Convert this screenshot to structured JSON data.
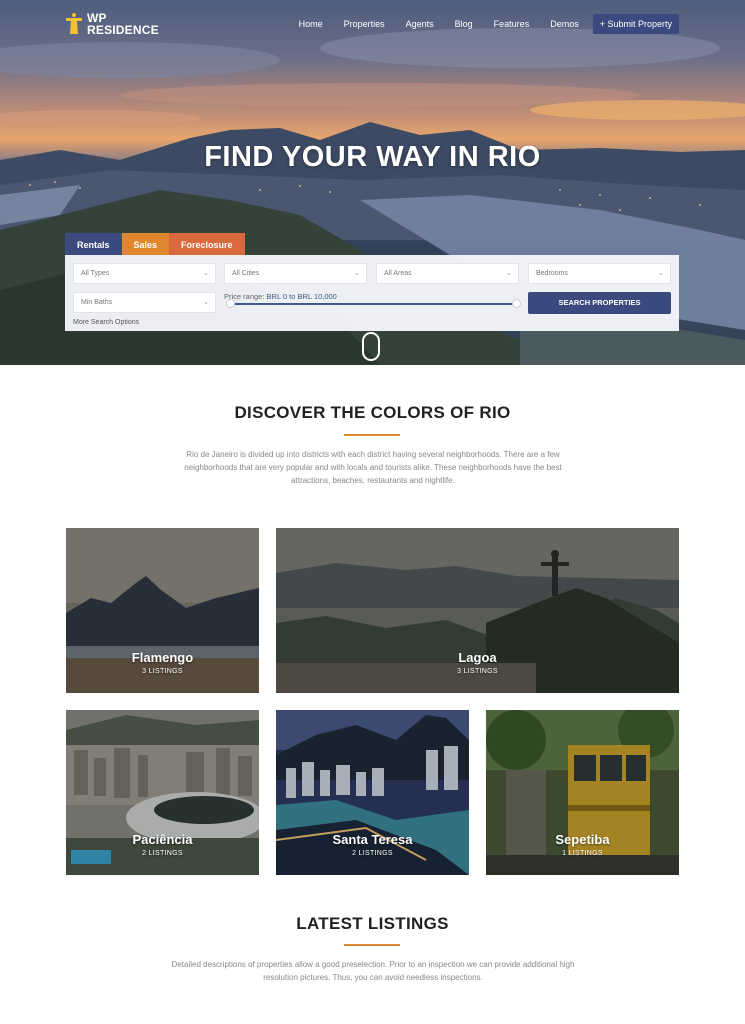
{
  "brand": {
    "line1": "WP",
    "line2": "RESIDENCE"
  },
  "nav": {
    "items": [
      "Home",
      "Properties",
      "Agents",
      "Blog",
      "Features",
      "Demos"
    ],
    "cta": "+ Submit Property"
  },
  "hero": {
    "title": "FIND YOUR WAY IN RIO"
  },
  "search": {
    "tabs": [
      "Rentals",
      "Sales",
      "Foreclosure"
    ],
    "fields": [
      "All Types",
      "All Cities",
      "All Areas",
      "Bedrooms",
      "Min Baths"
    ],
    "price_range_label": "Price range:",
    "price_range_value": "BRL 0 to BRL 10,000",
    "price_range_fraction": [
      0,
      1
    ],
    "button": "SEARCH PROPERTIES",
    "more": "More Search Options"
  },
  "discover": {
    "title": "DISCOVER THE COLORS OF RIO",
    "description": "Rio de Janeiro is divided up into districts with each district having several neighborhoods. There are a few neighborhoods that are very popular and with locals and tourists alike. These neighborhoods have the best attractions, beaches, restaurants and nightlife."
  },
  "neighborhoods": [
    {
      "name": "Flamengo",
      "count": "3 LISTINGS"
    },
    {
      "name": "Lagoa",
      "count": "3 LISTINGS"
    },
    {
      "name": "Paciência",
      "count": "2 LISTINGS"
    },
    {
      "name": "Santa Teresa",
      "count": "2 LISTINGS"
    },
    {
      "name": "Sepetiba",
      "count": "1 LISTINGS"
    }
  ],
  "latest": {
    "title": "LATEST LISTINGS",
    "description": "Detailed descriptions of properties allow a good preselection. Prior to an inspection we can provide additional high resolution pictures. Thus, you can avoid needless inspections."
  },
  "colors": {
    "primary": "#3b4a7e",
    "sales": "#e0872e",
    "foreclosure": "#d86a3d",
    "accent": "#d98a34"
  }
}
